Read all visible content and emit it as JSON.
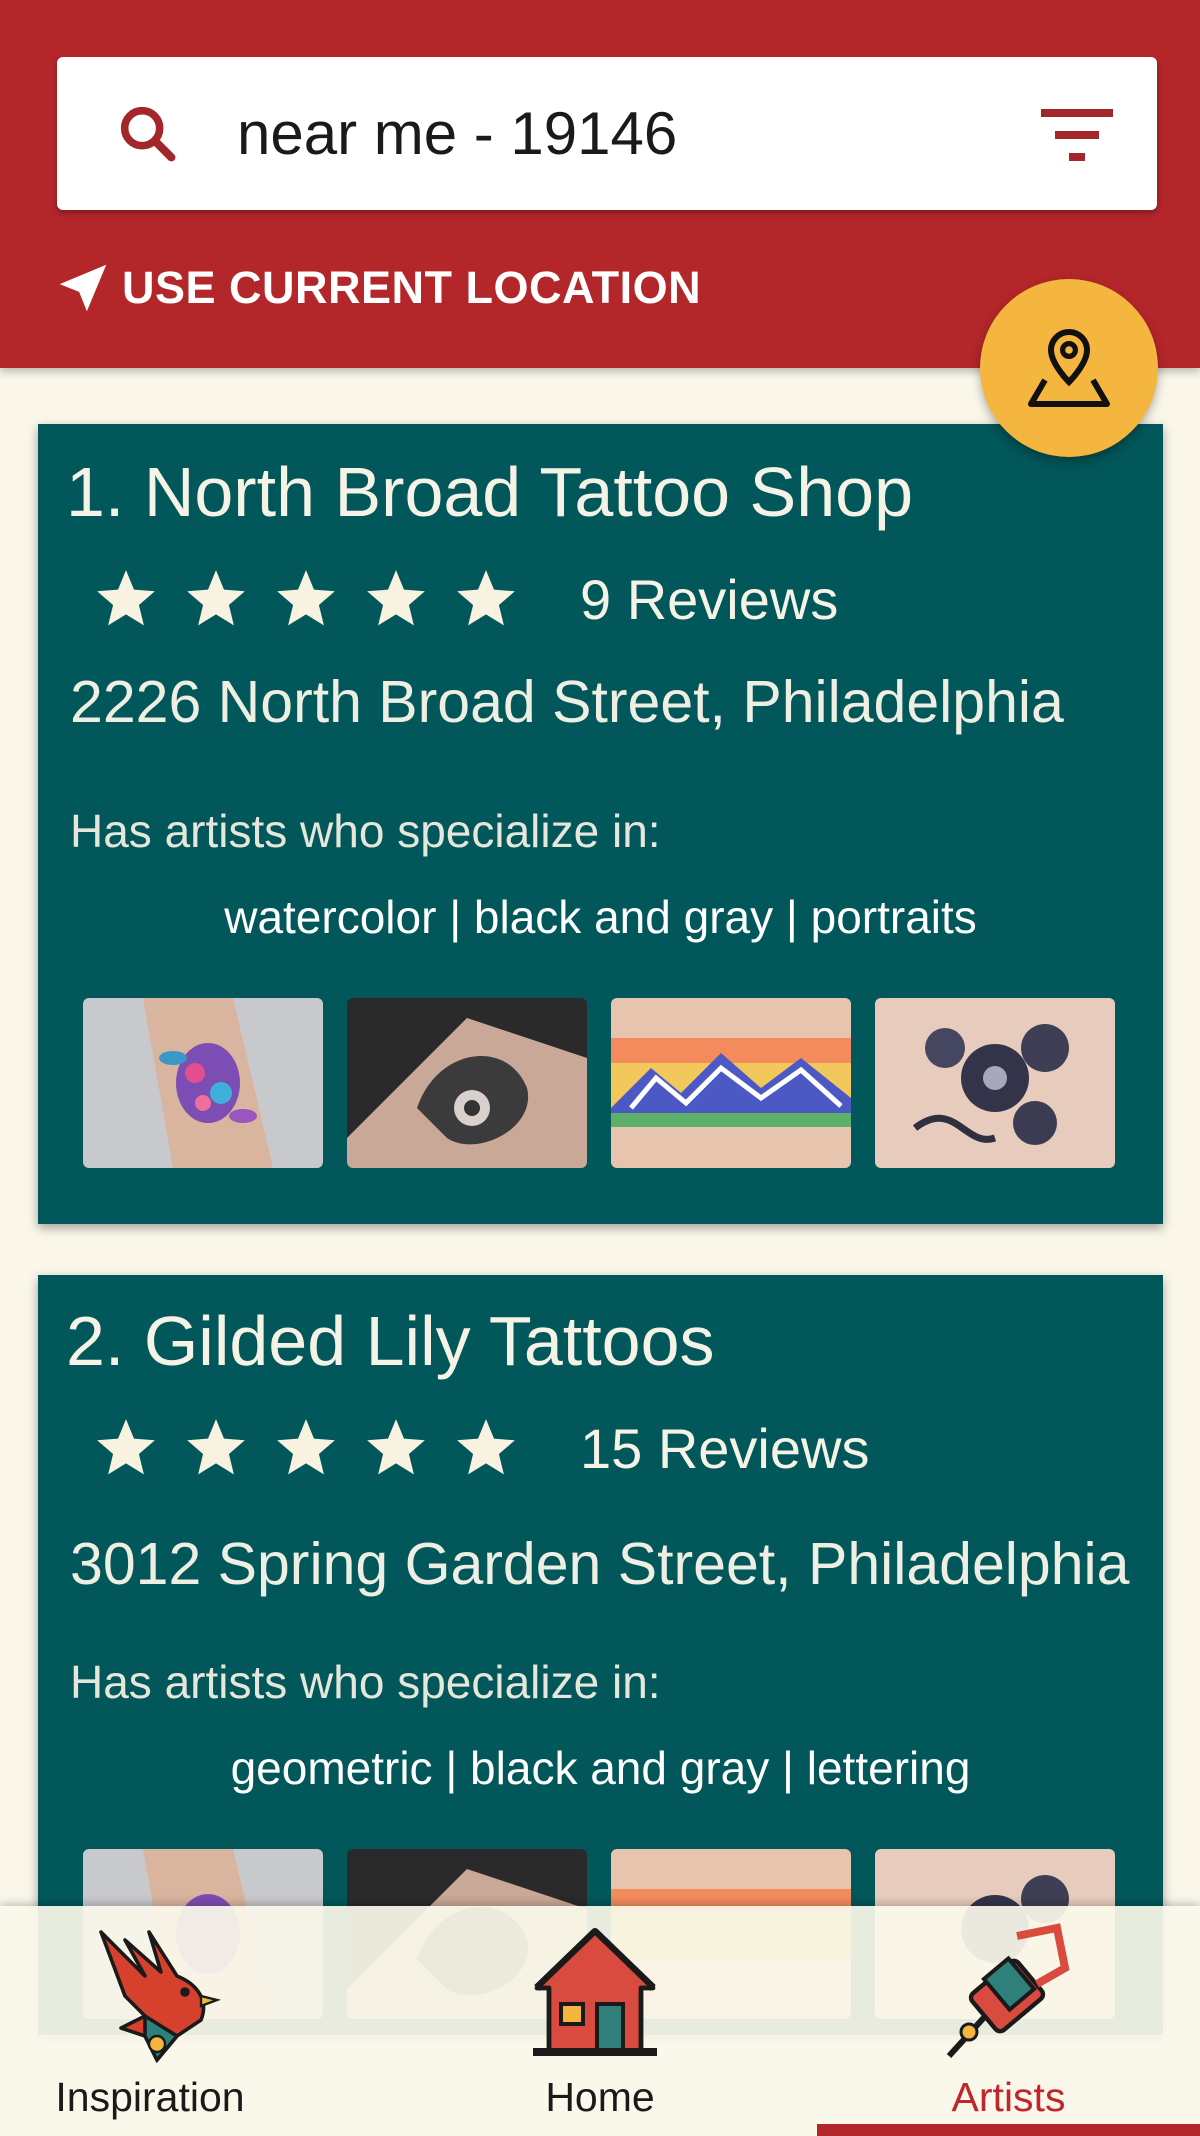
{
  "search": {
    "query": "near me - 19146",
    "search_icon": "search-icon",
    "filter_icon": "filter-icon"
  },
  "location": {
    "label": "USE CURRENT LOCATION",
    "icon": "navigation-arrow-icon"
  },
  "map_button": {
    "icon": "map-pin-icon"
  },
  "shops": [
    {
      "title": "1. North Broad Tattoo Shop",
      "rating": 5,
      "reviews": "9 Reviews",
      "address": "2226 North Broad Street, Philadelphia",
      "specialties_heading": "Has artists who specialize in:",
      "specialties": "watercolor | black and gray | portraits"
    },
    {
      "title": "2. Gilded Lily Tattoos",
      "rating": 5,
      "reviews": "15 Reviews",
      "address": "3012 Spring Garden Street, Philadelphia",
      "specialties_heading": "Has artists who specialize in:",
      "specialties": "geometric | black and gray | lettering"
    }
  ],
  "nav": {
    "items": [
      {
        "label": "Inspiration",
        "icon": "swallow-icon"
      },
      {
        "label": "Home",
        "icon": "house-icon"
      },
      {
        "label": "Artists",
        "icon": "tattoo-machine-icon"
      }
    ],
    "active": "Artists"
  },
  "colors": {
    "header": "#b3262a",
    "card": "#02575a",
    "accent": "#f4b63f",
    "background": "#faf7ea",
    "active_nav": "#c0272d"
  }
}
